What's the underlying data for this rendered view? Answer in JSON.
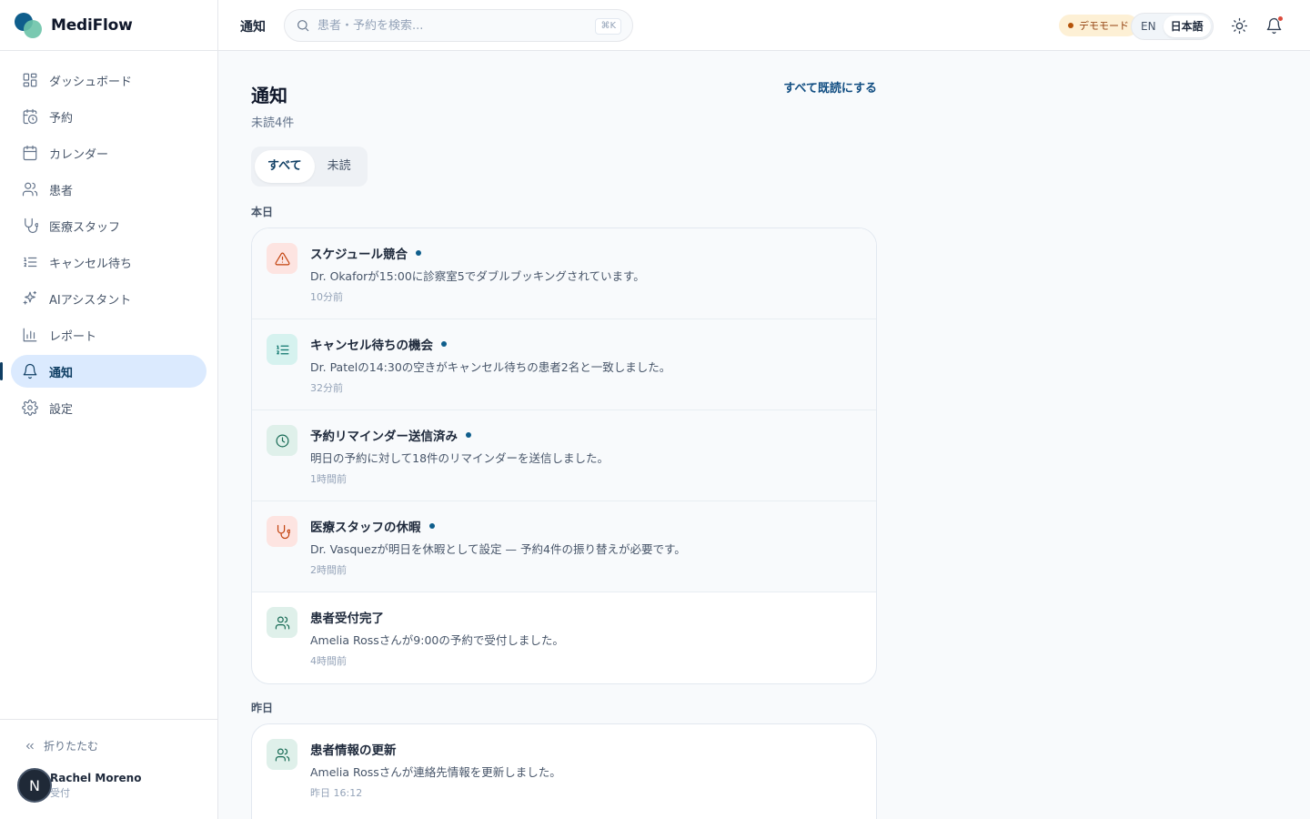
{
  "brand": {
    "name": "MediFlow"
  },
  "sidebar": {
    "items": [
      {
        "label": "ダッシュボード",
        "icon": "dashboard-icon",
        "active": false
      },
      {
        "label": "予約",
        "icon": "calendar-clock-icon",
        "active": false
      },
      {
        "label": "カレンダー",
        "icon": "calendar-icon",
        "active": false
      },
      {
        "label": "患者",
        "icon": "users-icon",
        "active": false
      },
      {
        "label": "医療スタッフ",
        "icon": "stethoscope-icon",
        "active": false
      },
      {
        "label": "キャンセル待ち",
        "icon": "list-ordered-icon",
        "active": false
      },
      {
        "label": "AIアシスタント",
        "icon": "sparkles-icon",
        "active": false
      },
      {
        "label": "レポート",
        "icon": "bar-chart-icon",
        "active": false
      },
      {
        "label": "通知",
        "icon": "bell-icon",
        "active": true
      },
      {
        "label": "設定",
        "icon": "gear-icon",
        "active": false
      }
    ],
    "collapse_label": "折りたたむ",
    "user": {
      "initial": "N",
      "name": "Rachel Moreno",
      "role": "受付"
    }
  },
  "header": {
    "title": "通知",
    "search_placeholder": "患者・予約を検索...",
    "search_shortcut": "⌘K",
    "demo_badge": "デモモード",
    "lang_en": "EN",
    "lang_ja": "日本語"
  },
  "main": {
    "title": "通知",
    "unread_count": "未読4件",
    "mark_all_read": "すべて既読にする",
    "tabs": [
      "すべて",
      "未読"
    ],
    "groups": [
      {
        "label": "本日",
        "items": [
          {
            "icon": "alert-triangle-icon",
            "tone": "red",
            "title": "スケジュール競合",
            "body": "Dr. Okaforが15:00に診察室5でダブルブッキングされています。",
            "time": "10分前",
            "unread": true
          },
          {
            "icon": "list-ordered-icon",
            "tone": "teal",
            "title": "キャンセル待ちの機会",
            "body": "Dr. Patelの14:30の空きがキャンセル待ちの患者2名と一致しました。",
            "time": "32分前",
            "unread": true
          },
          {
            "icon": "clock-icon",
            "tone": "green",
            "title": "予約リマインダー送信済み",
            "body": "明日の予約に対して18件のリマインダーを送信しました。",
            "time": "1時間前",
            "unread": true
          },
          {
            "icon": "stethoscope-icon",
            "tone": "red",
            "title": "医療スタッフの休暇",
            "body": "Dr. Vasquezが明日を休暇として設定 — 予約4件の振り替えが必要です。",
            "time": "2時間前",
            "unread": true
          },
          {
            "icon": "users-icon",
            "tone": "green",
            "title": "患者受付完了",
            "body": "Amelia Rossさんが9:00の予約で受付しました。",
            "time": "4時間前",
            "unread": false
          }
        ]
      },
      {
        "label": "昨日",
        "items": [
          {
            "icon": "users-icon",
            "tone": "green",
            "title": "患者情報の更新",
            "body": "Amelia Rossさんが連絡先情報を更新しました。",
            "time": "昨日 16:12",
            "unread": false
          }
        ]
      }
    ]
  }
}
